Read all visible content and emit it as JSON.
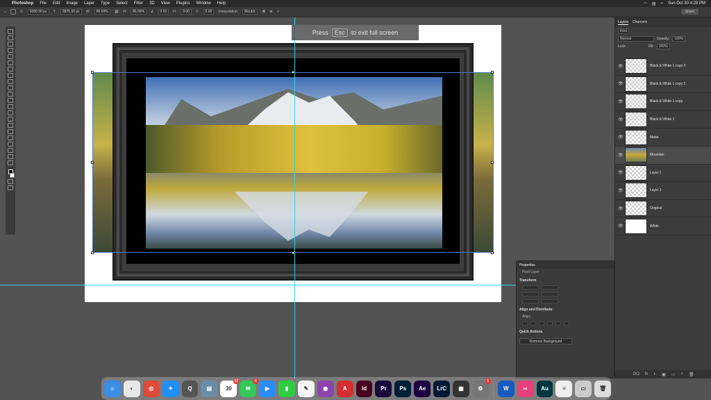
{
  "menubar": {
    "apple": "",
    "app": "Photoshop",
    "items": [
      "File",
      "Edit",
      "Image",
      "Layer",
      "Type",
      "Select",
      "Filter",
      "3D",
      "View",
      "Plugins",
      "Window",
      "Help"
    ],
    "datetime": "Sun Oct 30  4:28 PM"
  },
  "options": {
    "x_label": "X:",
    "x": "5000.00 px",
    "y_label": "Y:",
    "y": "5875.00 px",
    "w_label": "W:",
    "w": "86.69%",
    "h_label": "H:",
    "h": "86.69%",
    "angle": "0.00",
    "hskew_label": "H:",
    "hskew": "0.00",
    "vskew_label": "V:",
    "vskew": "0.00",
    "interp_label": "Interpolation:",
    "interp": "Bicubic",
    "share": "Share"
  },
  "fullscreen_hint": {
    "press": "Press",
    "key": "Esc",
    "text": "to exit full screen"
  },
  "layers_panel": {
    "tabs": [
      "Layers",
      "Channels"
    ],
    "kind": "Kind",
    "blend": "Normal",
    "opacity_label": "Opacity:",
    "opacity": "100%",
    "lock_label": "Lock:",
    "fill_label": "Fill:",
    "fill": "100%",
    "layers": [
      {
        "name": "Black & White 1 copy 3",
        "selected": false
      },
      {
        "name": "Black & White 1 copy 2",
        "selected": false
      },
      {
        "name": "Black & White 1 copy",
        "selected": false
      },
      {
        "name": "Black & White 1",
        "selected": false
      },
      {
        "name": "Matte",
        "selected": false
      },
      {
        "name": "Mountain",
        "selected": true
      },
      {
        "name": "Layer 2",
        "selected": false
      },
      {
        "name": "Layer 1",
        "selected": false
      },
      {
        "name": "Original",
        "selected": false
      },
      {
        "name": "White",
        "selected": false
      }
    ],
    "footer": [
      "GO",
      "fx",
      "◐",
      "▣",
      "▭",
      "+",
      "🗑"
    ]
  },
  "properties": {
    "title": "Properties",
    "layer_type": "Pixel Layer",
    "transform": "Transform",
    "align": "Align and Distribute",
    "align_sub": "Align:",
    "quick": "Quick Actions",
    "remove_bg": "Remove Background"
  },
  "dock": {
    "items": [
      {
        "name": "Finder",
        "label": "☺",
        "color": "#3a8ee6"
      },
      {
        "name": "Launchpad",
        "label": "◐",
        "color": "#e8e8e8"
      },
      {
        "name": "Chrome",
        "label": "◎",
        "color": "#dd4b39"
      },
      {
        "name": "Safari",
        "label": "✦",
        "color": "#1e90ff"
      },
      {
        "name": "QuickTime",
        "label": "Q",
        "color": "#555"
      },
      {
        "name": "Preview",
        "label": "▤",
        "color": "#6c8ca8"
      },
      {
        "name": "Calendar",
        "label": "30",
        "color": "#fff",
        "badge": "12"
      },
      {
        "name": "Messages",
        "label": "✉",
        "color": "#34c759",
        "badge": "4"
      },
      {
        "name": "Zoom",
        "label": "▶",
        "color": "#2d8cff"
      },
      {
        "name": "FaceTime",
        "label": "▮",
        "color": "#2ecc40"
      },
      {
        "name": "Notes",
        "label": "✎",
        "color": "#f5f5f5"
      },
      {
        "name": "Podcasts",
        "label": "◉",
        "color": "#8e44ad"
      },
      {
        "name": "Acrobat",
        "label": "A",
        "color": "#d32f2f"
      },
      {
        "name": "InDesign",
        "label": "Id",
        "color": "#49021f"
      },
      {
        "name": "Premiere",
        "label": "Pr",
        "color": "#1a0a3a"
      },
      {
        "name": "Photoshop",
        "label": "Ps",
        "color": "#001e36"
      },
      {
        "name": "After Effects",
        "label": "Ae",
        "color": "#1f0040"
      },
      {
        "name": "Lightroom Classic",
        "label": "LrC",
        "color": "#001a33"
      },
      {
        "name": "Calculator",
        "label": "▦",
        "color": "#333"
      },
      {
        "name": "System Settings",
        "label": "⚙",
        "color": "#777",
        "badge": "1"
      }
    ],
    "items_right": [
      {
        "name": "Word",
        "label": "W",
        "color": "#185abd"
      },
      {
        "name": "Creative Cloud",
        "label": "∞",
        "color": "#e8407a"
      },
      {
        "name": "Audition",
        "label": "Au",
        "color": "#00363f"
      },
      {
        "name": "Document",
        "label": "≡",
        "color": "#eee"
      },
      {
        "name": "Screenshot",
        "label": "▭",
        "color": "#ccc"
      },
      {
        "name": "Trash",
        "label": "🗑",
        "color": "#ddd"
      }
    ]
  }
}
